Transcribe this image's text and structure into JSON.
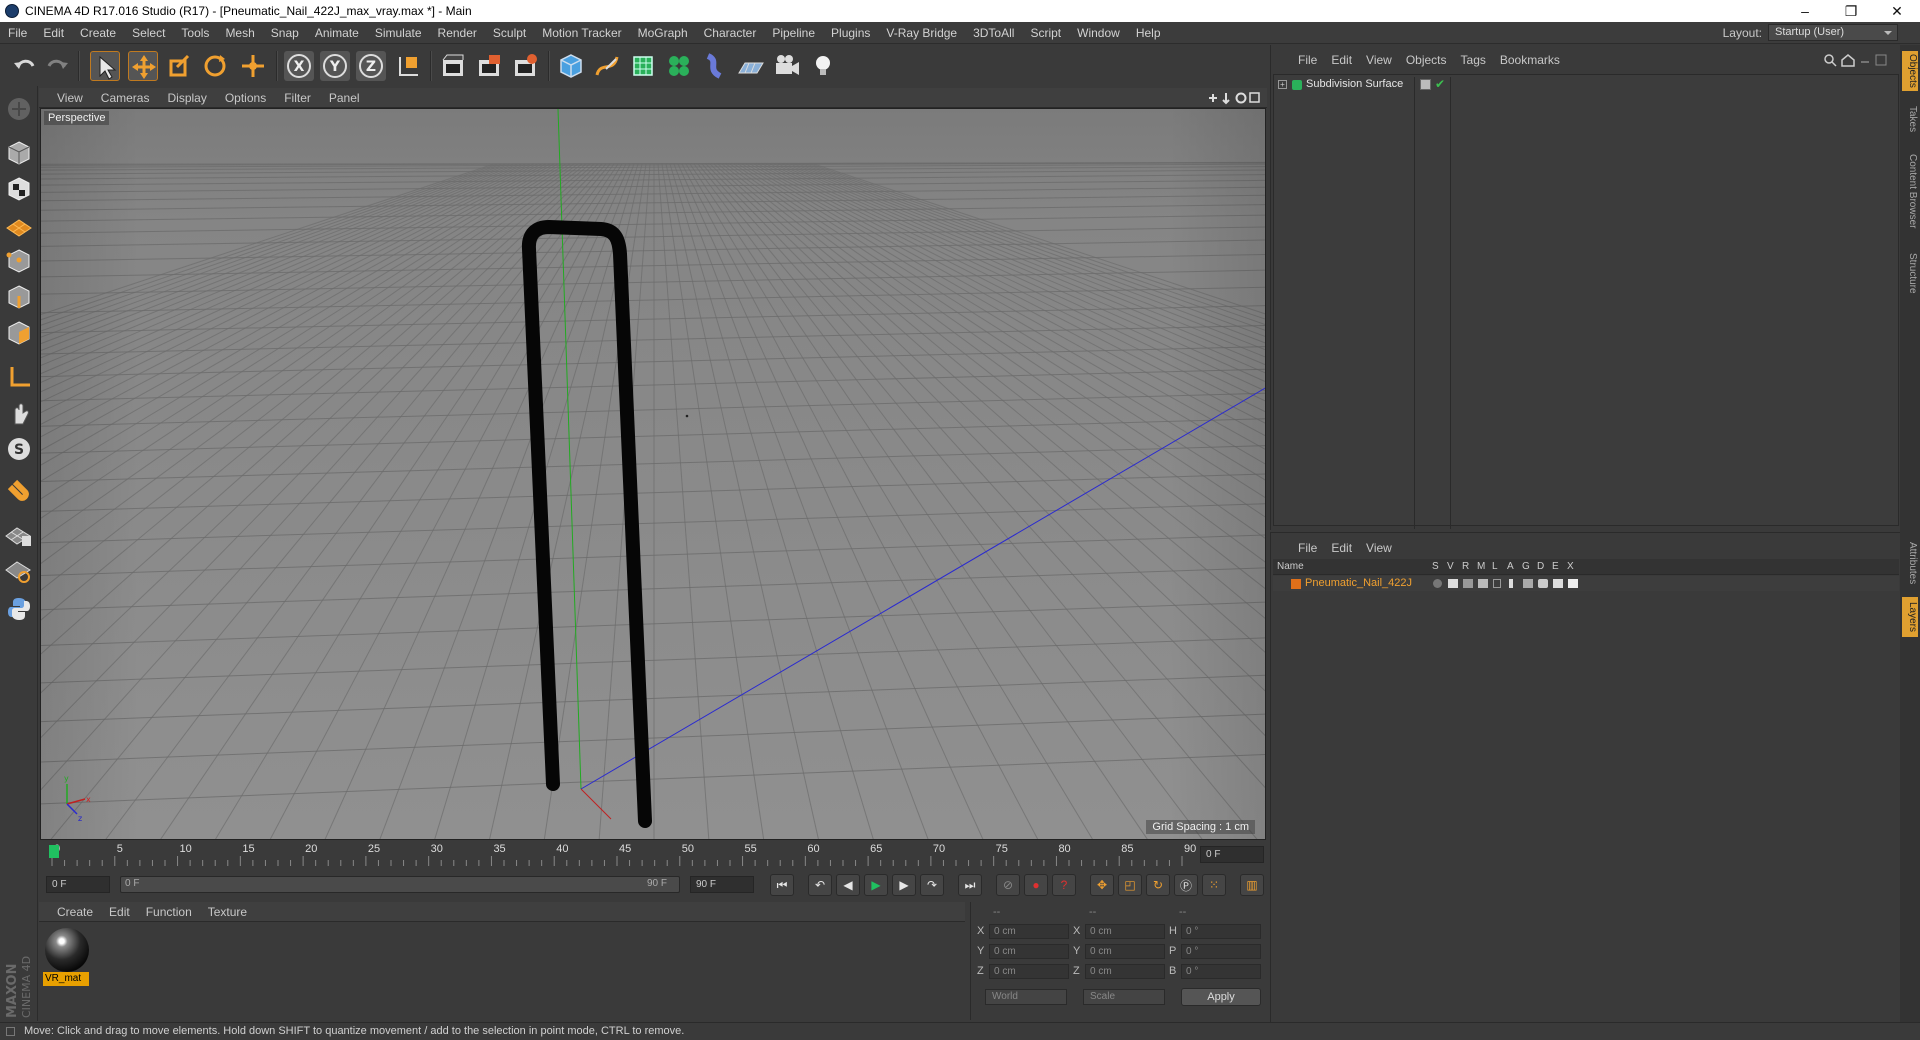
{
  "window": {
    "title": "CINEMA 4D R17.016 Studio (R17) - [Pneumatic_Nail_422J_max_vray.max *] - Main",
    "controls": [
      "–",
      "❐",
      "✕"
    ]
  },
  "menubar": {
    "items": [
      "File",
      "Edit",
      "Create",
      "Select",
      "Tools",
      "Mesh",
      "Snap",
      "Animate",
      "Simulate",
      "Render",
      "Sculpt",
      "Motion Tracker",
      "MoGraph",
      "Character",
      "Pipeline",
      "Plugins",
      "V-Ray Bridge",
      "3DToAll",
      "Script",
      "Window",
      "Help"
    ],
    "layout_label": "Layout:",
    "layout_value": "Startup (User)"
  },
  "viewport": {
    "menu": [
      "View",
      "Cameras",
      "Display",
      "Options",
      "Filter",
      "Panel"
    ],
    "camera_label": "Perspective",
    "grid_spacing": "Grid Spacing : 1 cm"
  },
  "timeline": {
    "ticks": [
      "0",
      "5",
      "10",
      "15",
      "20",
      "25",
      "30",
      "35",
      "40",
      "45",
      "50",
      "55",
      "60",
      "65",
      "70",
      "75",
      "80",
      "85",
      "90"
    ],
    "current_frame_field": "0 F",
    "start_field": "0 F",
    "range_start": "0 F",
    "range_end": "90 F",
    "end_field": "90 F"
  },
  "material_manager": {
    "menu": [
      "Create",
      "Edit",
      "Function",
      "Texture"
    ],
    "material_name": "VR_mat"
  },
  "coordinates": {
    "header": [
      "--",
      "--",
      "--"
    ],
    "rows": [
      {
        "a": "X",
        "av": "0 cm",
        "b": "X",
        "bv": "0 cm",
        "c": "H",
        "cv": "0 °"
      },
      {
        "a": "Y",
        "av": "0 cm",
        "b": "Y",
        "bv": "0 cm",
        "c": "P",
        "cv": "0 °"
      },
      {
        "a": "Z",
        "av": "0 cm",
        "b": "Z",
        "bv": "0 cm",
        "c": "B",
        "cv": "0 °"
      }
    ],
    "mode_world": "World",
    "mode_scale": "Scale",
    "apply_label": "Apply"
  },
  "object_manager": {
    "menu": [
      "File",
      "Edit",
      "View",
      "Objects",
      "Tags",
      "Bookmarks"
    ],
    "objects": [
      {
        "name": "Subdivision Surface"
      }
    ]
  },
  "layer_manager": {
    "menu": [
      "File",
      "Edit",
      "View"
    ],
    "columns": [
      "Name",
      "S",
      "V",
      "R",
      "M",
      "L",
      "A",
      "G",
      "D",
      "E",
      "X"
    ],
    "layers": [
      {
        "name": "Pneumatic_Nail_422J",
        "color": "#e0701a"
      }
    ]
  },
  "right_tabs": [
    "Objects",
    "Takes",
    "Content Browser",
    "Structure",
    "Attributes",
    "Layers"
  ],
  "logo": {
    "line1": "MAXON",
    "line2": "CINEMA 4D"
  },
  "status": "Move: Click and drag to move elements. Hold down SHIFT to quantize movement / add to the selection in point mode, CTRL to remove.",
  "colors": {
    "accent": "#e8a000",
    "active_tool": "#f0a030",
    "x_axis": "#c02020",
    "y_axis": "#20a020",
    "z_axis": "#2020c0"
  }
}
